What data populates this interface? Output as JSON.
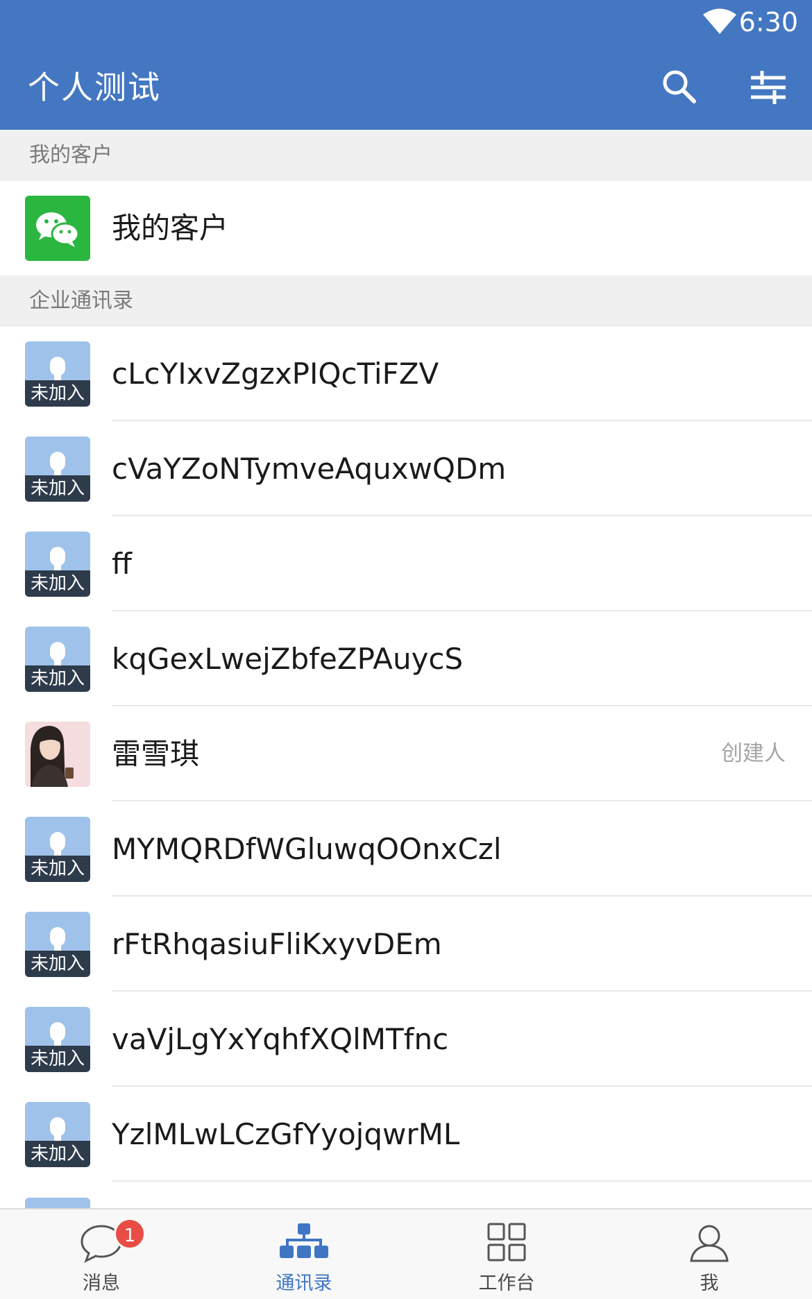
{
  "status_bar": {
    "time": "6:30",
    "wifi_icon": "wifi-icon"
  },
  "header": {
    "title": "个人测试",
    "search_icon": "search-icon",
    "filter_icon": "filter-icon"
  },
  "section_my_customers": {
    "header": "我的客户",
    "item_label": "我的客户",
    "icon": "wechat-icon"
  },
  "section_directory": {
    "header": "企业通讯录",
    "not_joined_badge": "未加入",
    "contacts": [
      {
        "name": "cLcYIxvZgzxPIQcTiFZV",
        "avatar": "default",
        "role": ""
      },
      {
        "name": "cVaYZoNTymveAquxwQDm",
        "avatar": "default",
        "role": ""
      },
      {
        "name": "ff",
        "avatar": "default",
        "role": ""
      },
      {
        "name": "kqGexLwejZbfeZPAuycS",
        "avatar": "default",
        "role": ""
      },
      {
        "name": "雷雪琪",
        "avatar": "photo",
        "role": "创建人"
      },
      {
        "name": "MYMQRDfWGluwqOOnxCzl",
        "avatar": "default",
        "role": ""
      },
      {
        "name": "rFtRhqasiuFliKxyvDEm",
        "avatar": "default",
        "role": ""
      },
      {
        "name": "vaVjLgYxYqhfXQlMTfnc",
        "avatar": "default",
        "role": ""
      },
      {
        "name": "YzlMLwLCzGfYyojqwrML",
        "avatar": "default",
        "role": ""
      }
    ]
  },
  "tabbar": {
    "tabs": [
      {
        "label": "消息",
        "icon": "chat-bubble-icon",
        "badge": "1"
      },
      {
        "label": "通讯录",
        "icon": "org-chart-icon",
        "active": true
      },
      {
        "label": "工作台",
        "icon": "grid-icon"
      },
      {
        "label": "我",
        "icon": "person-icon"
      }
    ]
  },
  "colors": {
    "header_bg": "#4477c1",
    "active_tab": "#3f76c4",
    "badge_red": "#e84c45",
    "wechat_green": "#2bb640"
  }
}
